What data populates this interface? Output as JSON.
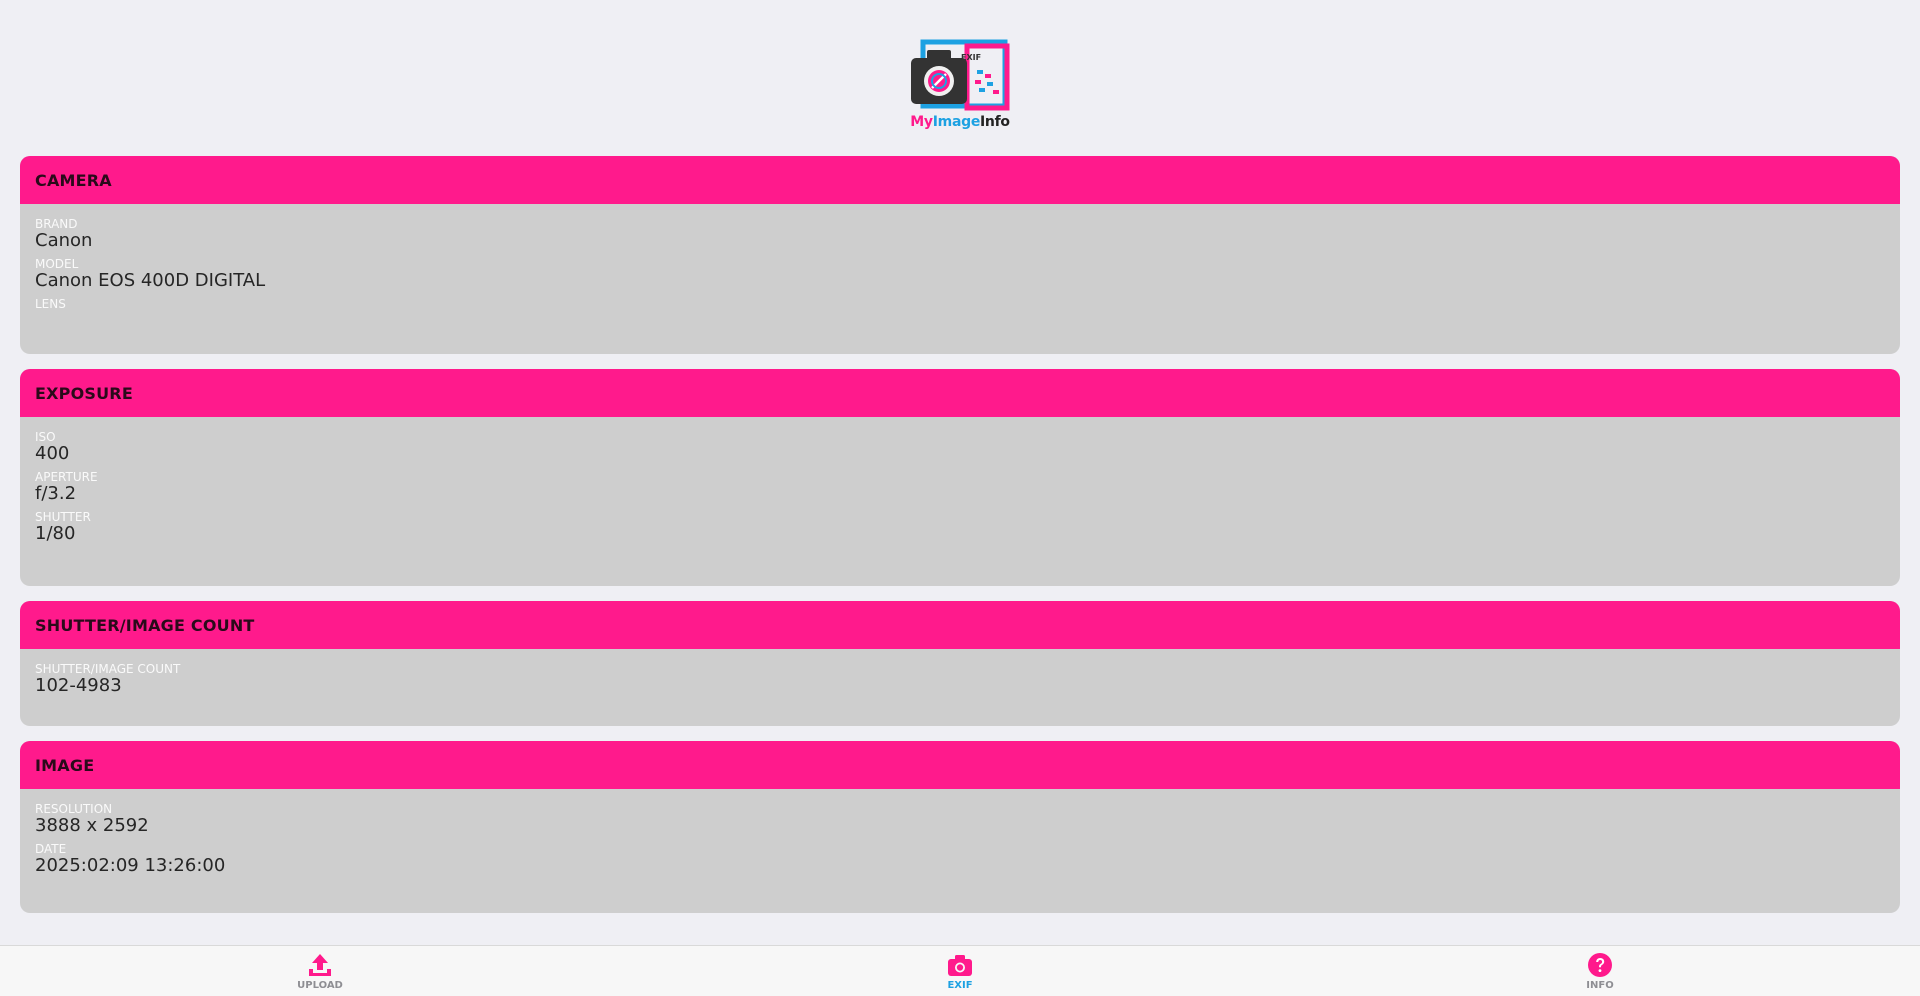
{
  "app": {
    "logo": {
      "part1": "My",
      "part2": "Image",
      "part3": "Info",
      "badge": "EXIF"
    }
  },
  "sections": [
    {
      "title": "CAMERA",
      "fields": [
        {
          "label": "BRAND",
          "value": "Canon"
        },
        {
          "label": "MODEL",
          "value": "Canon EOS 400D DIGITAL"
        },
        {
          "label": "LENS",
          "value": ""
        }
      ]
    },
    {
      "title": "EXPOSURE",
      "fields": [
        {
          "label": "ISO",
          "value": "400"
        },
        {
          "label": "APERTURE",
          "value": "f/3.2"
        },
        {
          "label": "SHUTTER",
          "value": "1/80"
        }
      ]
    },
    {
      "title": "SHUTTER/IMAGE COUNT",
      "fields": [
        {
          "label": "SHUTTER/IMAGE COUNT",
          "value": "102-4983"
        }
      ]
    },
    {
      "title": "IMAGE",
      "fields": [
        {
          "label": "RESOLUTION",
          "value": "3888 x 2592"
        },
        {
          "label": "DATE",
          "value": "2025:02:09 13:26:00"
        }
      ]
    }
  ],
  "tabs": [
    {
      "label": "UPLOAD",
      "icon": "upload-icon"
    },
    {
      "label": "EXIF",
      "icon": "camera-icon",
      "active": true
    },
    {
      "label": "INFO",
      "icon": "question-icon"
    }
  ],
  "colors": {
    "accent": "#ff1a8c",
    "active_tab": "#1da1e2",
    "card_body": "#cecece"
  }
}
